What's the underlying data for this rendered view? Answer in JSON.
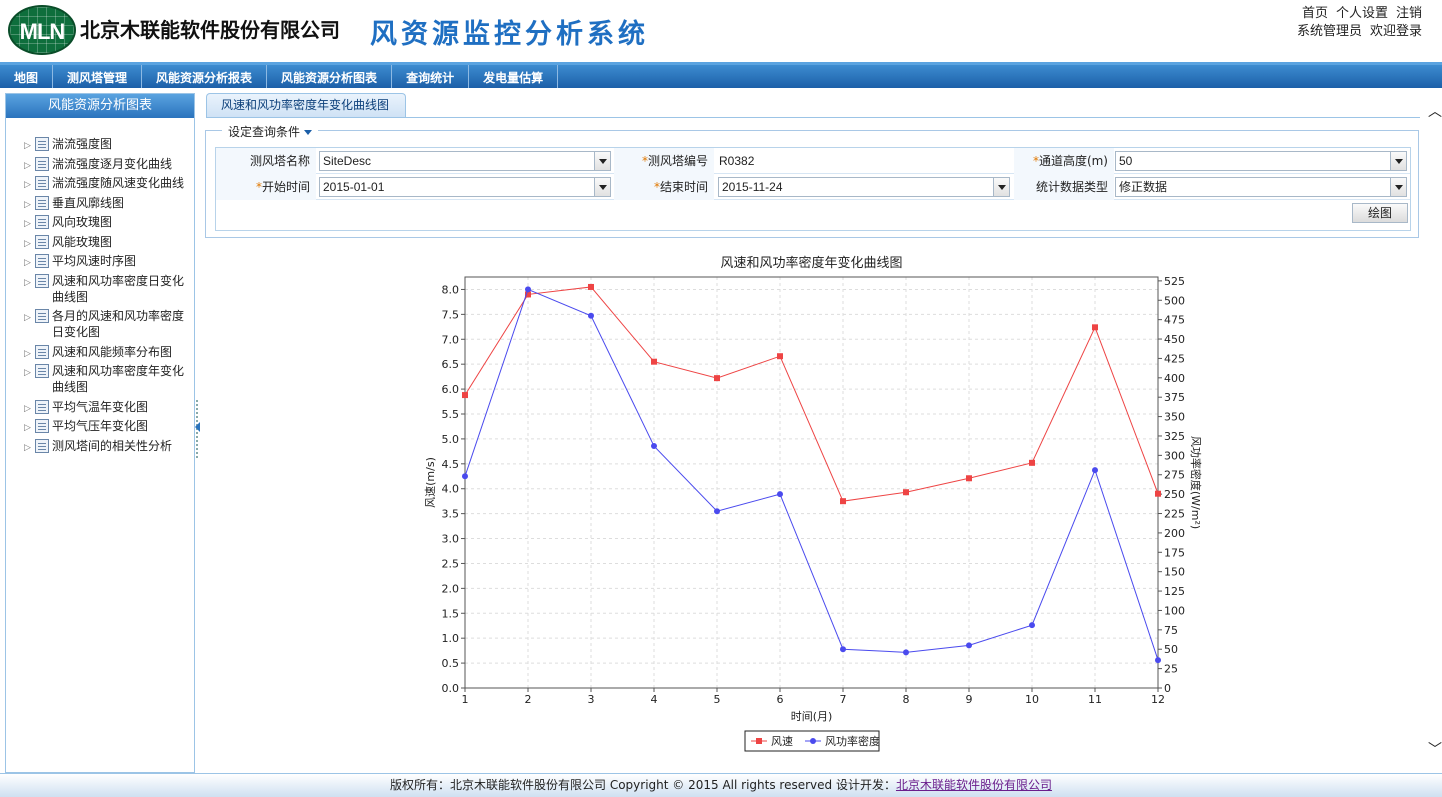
{
  "header": {
    "logo_text": "MLN",
    "company": "北京木联能软件股份有限公司",
    "system_title": "风资源监控分析系统",
    "links": [
      "首页",
      "个人设置",
      "注销"
    ],
    "user": "系统管理员",
    "welcome": "欢迎登录"
  },
  "nav": {
    "items": [
      "地图",
      "测风塔管理",
      "风能资源分析报表",
      "风能资源分析图表",
      "查询统计",
      "发电量估算"
    ]
  },
  "sidebar": {
    "title": "风能资源分析图表",
    "items": [
      "湍流强度图",
      "湍流强度逐月变化曲线",
      "湍流强度随风速变化曲线",
      "垂直风廓线图",
      "风向玫瑰图",
      "风能玫瑰图",
      "平均风速时序图",
      "风速和风功率密度日变化曲线图",
      "各月的风速和风功率密度日变化图",
      "风速和风能频率分布图",
      "风速和风功率密度年变化曲线图",
      "平均气温年变化图",
      "平均气压年变化图",
      "测风塔间的相关性分析"
    ]
  },
  "main": {
    "tab": "风速和风功率密度年变化曲线图",
    "query_legend": "设定查询条件",
    "fields": {
      "site_name_label": "测风塔名称",
      "site_name": "SiteDesc",
      "site_code_label": "测风塔编号",
      "site_code": "R0382",
      "height_label": "通道高度(m)",
      "height": "50",
      "start_label": "开始时间",
      "start": "2015-01-01",
      "end_label": "结束时间",
      "end": "2015-11-24",
      "stat_label": "统计数据类型",
      "stat": "修正数据"
    },
    "draw_button": "绘图"
  },
  "chart_data": {
    "type": "line",
    "title": "风速和风功率密度年变化曲线图",
    "xlabel": "时间(月)",
    "ylabel": "风速(m/s)",
    "y2label": "风功率密度(W/m²)",
    "x": [
      1,
      2,
      3,
      4,
      5,
      6,
      7,
      8,
      9,
      10,
      11,
      12
    ],
    "xlim": [
      1,
      12
    ],
    "ylim": [
      0,
      8.25
    ],
    "y2lim": [
      0,
      530
    ],
    "yticks": [
      "0.0",
      "0.5",
      "1.0",
      "1.5",
      "2.0",
      "2.5",
      "3.0",
      "3.5",
      "4.0",
      "4.5",
      "5.0",
      "5.5",
      "6.0",
      "6.5",
      "7.0",
      "7.5",
      "8.0"
    ],
    "y2ticks": [
      "0",
      "25",
      "50",
      "75",
      "100",
      "125",
      "150",
      "175",
      "200",
      "225",
      "250",
      "275",
      "300",
      "325",
      "350",
      "375",
      "400",
      "425",
      "450",
      "475",
      "500",
      "525"
    ],
    "grid": true,
    "legend": "bottom",
    "series": [
      {
        "name": "风速",
        "axis": "left",
        "color": "#ee4444",
        "marker": "square",
        "values": [
          5.88,
          7.9,
          8.05,
          6.55,
          6.22,
          6.66,
          3.75,
          3.93,
          4.21,
          4.52,
          7.24,
          3.9
        ]
      },
      {
        "name": "风功率密度",
        "axis": "right",
        "color": "#4a4aee",
        "marker": "circle",
        "values": [
          273,
          514,
          480,
          312,
          228,
          250,
          50,
          46,
          55,
          81,
          281,
          36
        ]
      }
    ]
  },
  "footer": {
    "copyright": "版权所有：北京木联能软件股份有限公司  Copyright © 2015 All rights reserved 设计开发：",
    "developer": "北京木联能软件股份有限公司"
  }
}
